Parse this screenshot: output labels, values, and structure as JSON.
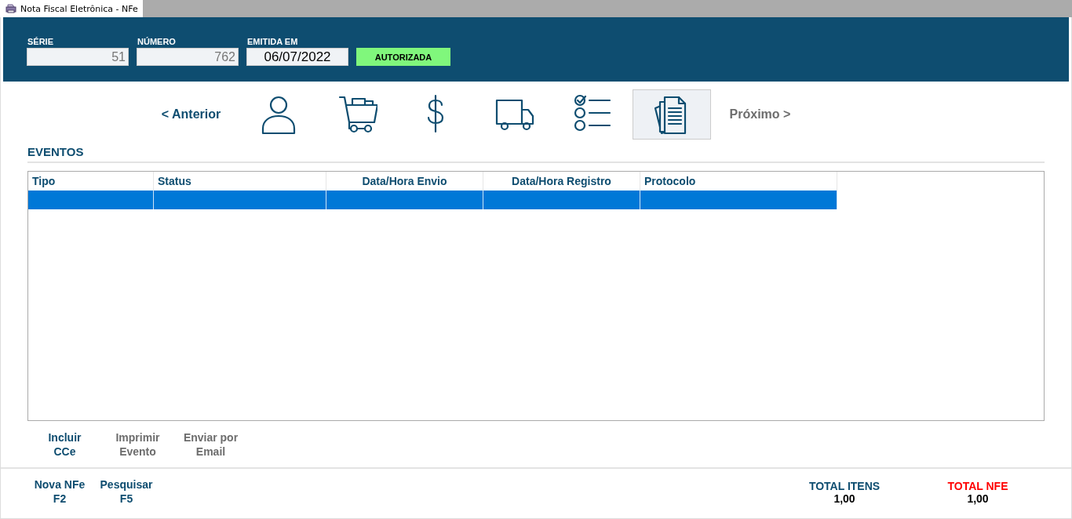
{
  "window": {
    "title": "Nota Fiscal Eletrônica - NFe"
  },
  "header": {
    "fields": [
      {
        "label": "SÉRIE",
        "value": "51",
        "disabled": true
      },
      {
        "label": "NÚMERO",
        "value": "762",
        "disabled": true
      },
      {
        "label": "EMITIDA EM",
        "value": "06/07/2022",
        "disabled": false
      }
    ],
    "status": "AUTORIZADA"
  },
  "nav": {
    "previous": {
      "label": "< Anterior",
      "disabled": false
    },
    "steps": [
      {
        "kind": "person",
        "selected": false
      },
      {
        "kind": "cart",
        "selected": false
      },
      {
        "kind": "dollar",
        "selected": false
      },
      {
        "kind": "truck",
        "selected": false
      },
      {
        "kind": "checklist",
        "selected": false
      },
      {
        "kind": "documents",
        "selected": true
      }
    ],
    "next": {
      "label": "Próximo >",
      "disabled": true
    }
  },
  "section_title": "EVENTOS",
  "table": {
    "columns": [
      {
        "label": "Tipo",
        "kind": "text"
      },
      {
        "label": "Status",
        "kind": "text"
      },
      {
        "label": "Data/Hora Envio",
        "kind": "datetime"
      },
      {
        "label": "Data/Hora Registro",
        "kind": "datetime"
      },
      {
        "label": "Protocolo",
        "kind": "text"
      }
    ],
    "rows": [
      {
        "selected": true
      }
    ]
  },
  "actions": [
    {
      "label": "Incluir\nCCe",
      "disabled": false
    },
    {
      "label": "Imprimir\nEvento",
      "disabled": true
    },
    {
      "label": "Enviar por\nEmail",
      "disabled": true
    }
  ],
  "footer_actions": [
    {
      "label": "Nova NFe\nF2"
    },
    {
      "label": "Pesquisar\nF5"
    }
  ],
  "totals": [
    {
      "label": "TOTAL ITENS",
      "value": "1,00",
      "highlight": false
    },
    {
      "label": "TOTAL NFE",
      "value": "1,00",
      "highlight": true
    }
  ]
}
